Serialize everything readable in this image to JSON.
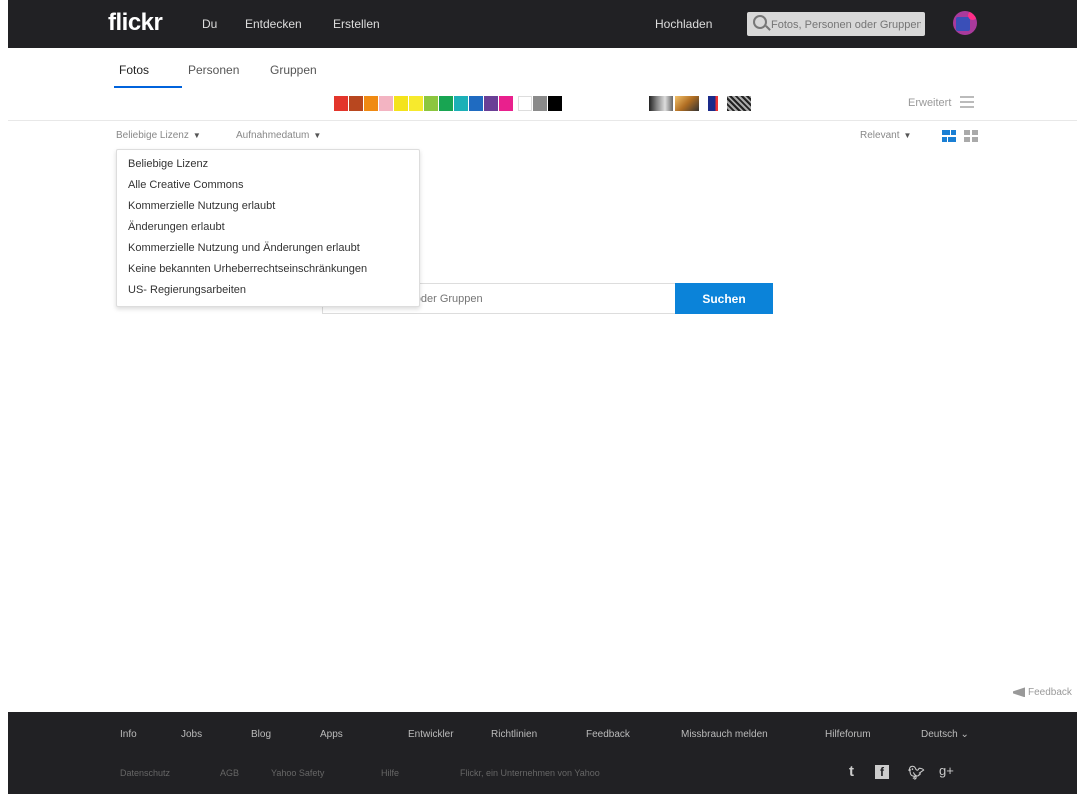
{
  "topnav": {
    "logo": "flickr",
    "links": [
      "Du",
      "Entdecken",
      "Erstellen"
    ],
    "upload": "Hochladen",
    "search_placeholder": "Fotos, Personen oder Gruppen"
  },
  "tabs": [
    "Fotos",
    "Personen",
    "Gruppen"
  ],
  "colors": [
    "#e3352b",
    "#b8471f",
    "#f08a12",
    "#f3b4c2",
    "#f4e31b",
    "#f7ea2d",
    "#8cc63f",
    "#18a552",
    "#1cb0b7",
    "#1f6bc1",
    "#6a3f96",
    "#e9208d",
    "#ffffff",
    "#8a8a8a",
    "#000000"
  ],
  "styles": [
    "black-white",
    "shallow-depth",
    "minimalist",
    "patterns"
  ],
  "advanced_label": "Erweitert",
  "filters": {
    "license": "Beliebige Lizenz",
    "date": "Aufnahmedatum"
  },
  "sort": "Relevant",
  "dropdown_items": [
    "Beliebige Lizenz",
    "Alle Creative Commons",
    "Kommerzielle Nutzung erlaubt",
    "Änderungen erlaubt",
    "Kommerzielle Nutzung und Änderungen erlaubt",
    "Keine bekannten Urheberrechtseinschränkungen",
    "US- Regierungsarbeiten"
  ],
  "main_search": {
    "placeholder": "Fotos, Personen oder Gruppen",
    "button": "Suchen"
  },
  "feedback_side": "Feedback",
  "footer": {
    "row1": [
      "Info",
      "Jobs",
      "Blog",
      "Apps",
      "Entwickler",
      "Richtlinien",
      "Feedback",
      "Missbrauch melden",
      "Hilfeforum",
      "Deutsch"
    ],
    "row2": [
      "Datenschutz",
      "AGB",
      "Yahoo Safety",
      "Hilfe",
      "Flickr, ein Unternehmen von Yahoo"
    ],
    "social": [
      "t",
      "f",
      "y",
      "g+"
    ]
  }
}
